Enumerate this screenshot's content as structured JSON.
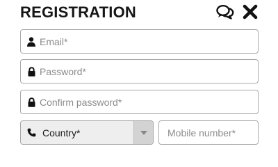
{
  "header": {
    "title": "REGISTRATION",
    "chat_icon": "chat-bubbles-icon",
    "close_icon": "close-icon"
  },
  "form": {
    "email": {
      "placeholder": "Email*",
      "value": "",
      "icon": "user-icon"
    },
    "password": {
      "placeholder": "Password*",
      "value": "",
      "icon": "lock-icon"
    },
    "confirm_password": {
      "placeholder": "Confirm password*",
      "value": "",
      "icon": "lock-icon"
    },
    "country": {
      "selected": "Country*",
      "icon": "phone-icon",
      "dropdown_icon": "caret-down-icon"
    },
    "mobile": {
      "placeholder": "Mobile number*",
      "value": ""
    }
  },
  "colors": {
    "text": "#161616",
    "border": "#a9a9a9",
    "placeholder": "#8c8c8c",
    "select_bg": "#eeeeee",
    "select_arrow_bg": "#d3d3d3"
  }
}
